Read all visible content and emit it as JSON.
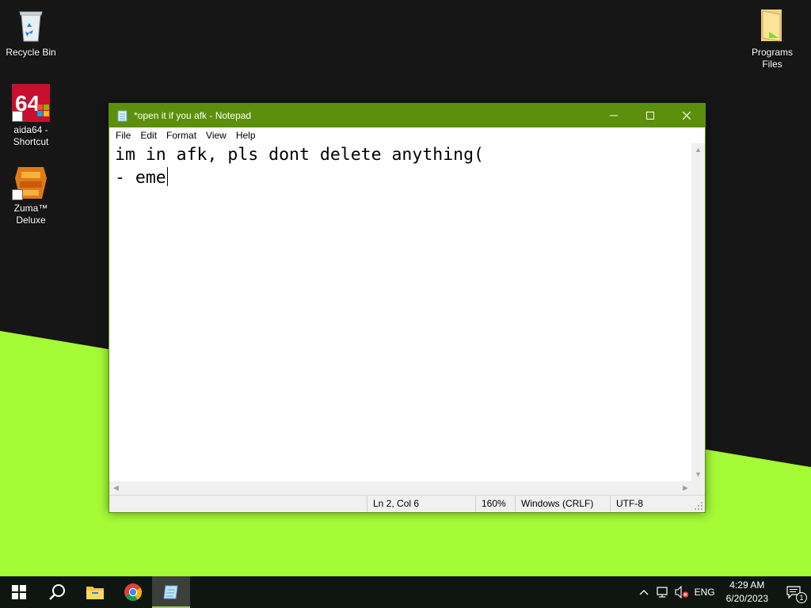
{
  "desktop": {
    "wallpaper_colors": {
      "dark": "#161616",
      "green": "#a4fb36"
    },
    "icons": [
      {
        "label": "Recycle Bin",
        "icon": "recycle-bin-icon"
      },
      {
        "label": "aida64 -\nShortcut",
        "icon": "aida64-icon"
      },
      {
        "label": "Zuma™\nDeluxe",
        "icon": "zuma-icon"
      },
      {
        "label": "Programs\nFiles",
        "icon": "folder-icon"
      }
    ]
  },
  "notepad": {
    "title": "*open it if you afk - Notepad",
    "accent": "#5c8f0c",
    "menu": [
      "File",
      "Edit",
      "Format",
      "View",
      "Help"
    ],
    "content": {
      "line1": "im in afk, pls dont delete anything(",
      "line2": "- eme"
    },
    "status": {
      "position": "Ln 2, Col 6",
      "zoom": "160%",
      "line_ending": "Windows (CRLF)",
      "encoding": "UTF-8"
    }
  },
  "taskbar": {
    "buttons": [
      "start-icon",
      "search-icon",
      "file-explorer-icon",
      "chrome-icon",
      "notepad-icon"
    ],
    "active": "notepad-icon",
    "tray": {
      "language": "ENG",
      "time": "4:29 AM",
      "date": "6/20/2023",
      "notification_count": "1"
    }
  }
}
